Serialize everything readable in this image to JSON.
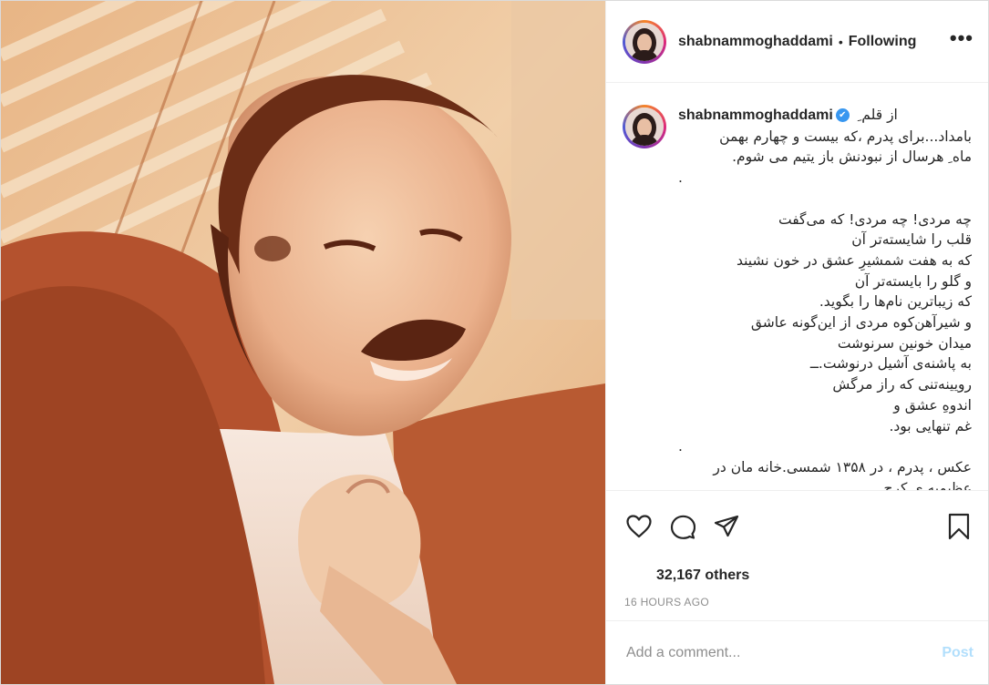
{
  "header": {
    "username": "shabnammoghaddami",
    "separator": "•",
    "follow_status": "Following",
    "more_icon": "more-horizontal-icon"
  },
  "caption": {
    "username": "shabnammoghaddami",
    "first_line": "از قلم ِ",
    "lines": [
      "بامداد...برای پدرم ،که بیست و چهارم بهمن",
      "ماه ِ هرسال از نبودنش باز یتیم می شوم.",
      ".",
      "",
      "چه مردی! چه مردی! که می‌گفت",
      "قلب را شایسته‌تر آن",
      "که به هفت شمشیرِ عشق در خون نشیند",
      "و گلو را بایسته‌تر آن",
      "که زیباترین نام‌ها را بگوید.",
      "و شیرآهن‌کوه مردی از این‌گونه عاشق",
      "میدان خونین سرنوشت",
      "به پاشنه‌ی آشیل درنوشت.ــ",
      "رویینه‌تنی که راز مرگش",
      "اندوهِ عشق و",
      "غم تنهایی بود.",
      ".",
      "عکس ، پدرم ، در ۱۳۵۸ شمسی.خانه مان در",
      "عظیمیه ی کرج."
    ]
  },
  "actions": {
    "like_icon": "heart-icon",
    "comment_icon": "comment-icon",
    "share_icon": "share-icon",
    "save_icon": "bookmark-icon"
  },
  "likes": "32,167 others",
  "timestamp": "16 HOURS AGO",
  "comment_box": {
    "placeholder": "Add a comment...",
    "post_label": "Post"
  },
  "colors": {
    "text": "#262626",
    "secondary": "#8e8e8e",
    "verified": "#3897f0",
    "post_disabled": "#b2dffc"
  }
}
